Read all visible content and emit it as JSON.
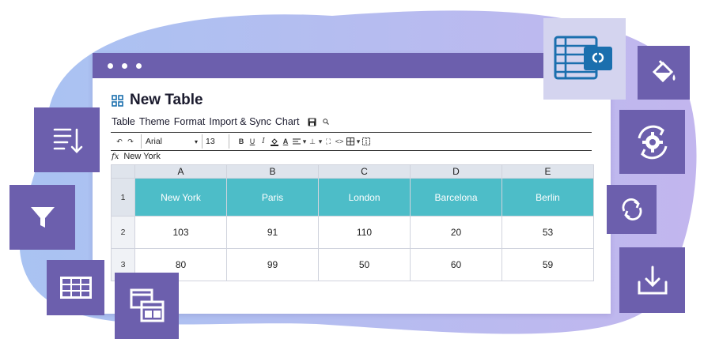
{
  "colors": {
    "brand": "#6c5fad",
    "header_fill": "#4dbdc8",
    "background_blob": "#b6b6ee",
    "tile_light": "#d4d4ef",
    "excel_blue": "#1b6fae"
  },
  "app": {
    "title": "New Table",
    "title_icon": "grid-icon"
  },
  "menu": {
    "items": [
      "Table",
      "Theme",
      "Format",
      "Import & Sync",
      "Chart"
    ],
    "icons": [
      "save-icon",
      "search-icon"
    ]
  },
  "toolbar": {
    "font_family": "Arial",
    "font_size": "13",
    "bold": "B",
    "underline": "U",
    "italic": "I"
  },
  "formula_bar": {
    "fx_label": "fx",
    "value": "New York"
  },
  "sheet": {
    "columns": [
      "A",
      "B",
      "C",
      "D",
      "E"
    ],
    "rows": [
      {
        "num": "1",
        "cells": [
          "New York",
          "Paris",
          "London",
          "Barcelona",
          "Berlin"
        ]
      },
      {
        "num": "2",
        "cells": [
          "103",
          "91",
          "110",
          "20",
          "53"
        ]
      },
      {
        "num": "3",
        "cells": [
          "80",
          "99",
          "50",
          "60",
          "59"
        ]
      }
    ]
  },
  "side_tiles": {
    "left": [
      "sort-icon",
      "filter-icon",
      "table-icon",
      "multi-table-icon"
    ],
    "right": [
      "excel-sync-icon",
      "paint-bucket-icon",
      "settings-sync-icon",
      "refresh-icon",
      "download-icon"
    ]
  }
}
